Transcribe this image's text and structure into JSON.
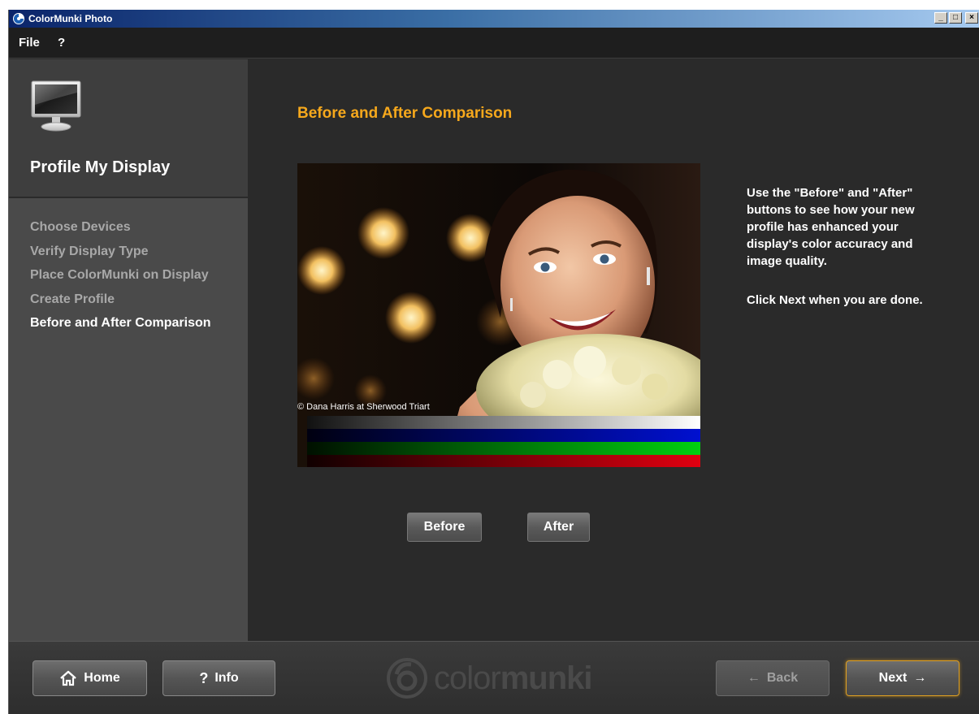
{
  "window": {
    "title": "ColorMunki Photo",
    "minimize_label": "_",
    "maximize_label": "□",
    "close_label": "×"
  },
  "menu": {
    "file": "File",
    "help": "?"
  },
  "sidebar": {
    "title": "Profile My Display",
    "steps": [
      {
        "label": "Choose Devices",
        "active": false
      },
      {
        "label": "Verify Display Type",
        "active": false
      },
      {
        "label": "Place ColorMunki on Display",
        "active": false
      },
      {
        "label": "Create Profile",
        "active": false
      },
      {
        "label": "Before and After Comparison",
        "active": true
      }
    ]
  },
  "main": {
    "title": "Before and After Comparison",
    "photo_credit": "© Dana Harris at Sherwood Triart",
    "description_1": "Use the \"Before\" and \"After\" buttons to see how your new profile has enhanced your display's color accuracy and image quality.",
    "description_2": "Click Next when you are done.",
    "before_label": "Before",
    "after_label": "After",
    "color_bars": [
      "#ffffff",
      "#0010d0",
      "#00d010",
      "#e00010"
    ]
  },
  "footer": {
    "home_label": "Home",
    "info_label": "Info",
    "info_icon": "?",
    "back_label": "Back",
    "next_label": "Next",
    "logo_text_light": "color",
    "logo_text_bold": "munki"
  },
  "colors": {
    "accent": "#f6a81c",
    "background": "#2a2a2a",
    "sidebar": "#4a4a4a"
  }
}
